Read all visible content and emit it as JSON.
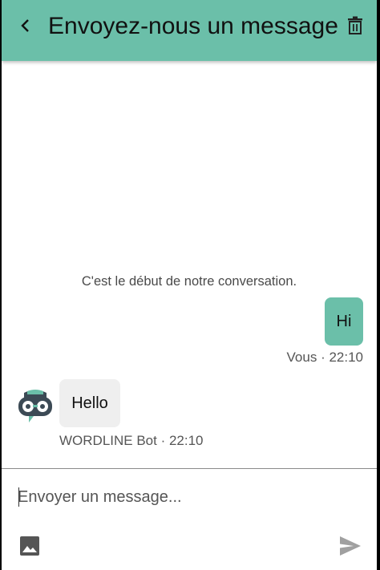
{
  "colors": {
    "accent": "#6bbfa9",
    "bot_bubble": "#efefef",
    "icon_muted": "#a0a0a0",
    "icon_dark": "#555555"
  },
  "header": {
    "title": "Envoyez-nous un message",
    "back_icon": "chevron-left-icon",
    "delete_icon": "trash-icon"
  },
  "conversation": {
    "start_note": "C'est le début de notre conversation.",
    "messages": [
      {
        "from": "user",
        "text": "Hi",
        "meta": "Vous · 22:10"
      },
      {
        "from": "bot",
        "text": "Hello",
        "meta": "WORDLINE Bot · 22:10",
        "avatar_icon": "bot-avatar-icon"
      }
    ]
  },
  "composer": {
    "placeholder": "Envoyer un message...",
    "value": "",
    "image_icon": "image-icon",
    "send_icon": "send-icon"
  }
}
